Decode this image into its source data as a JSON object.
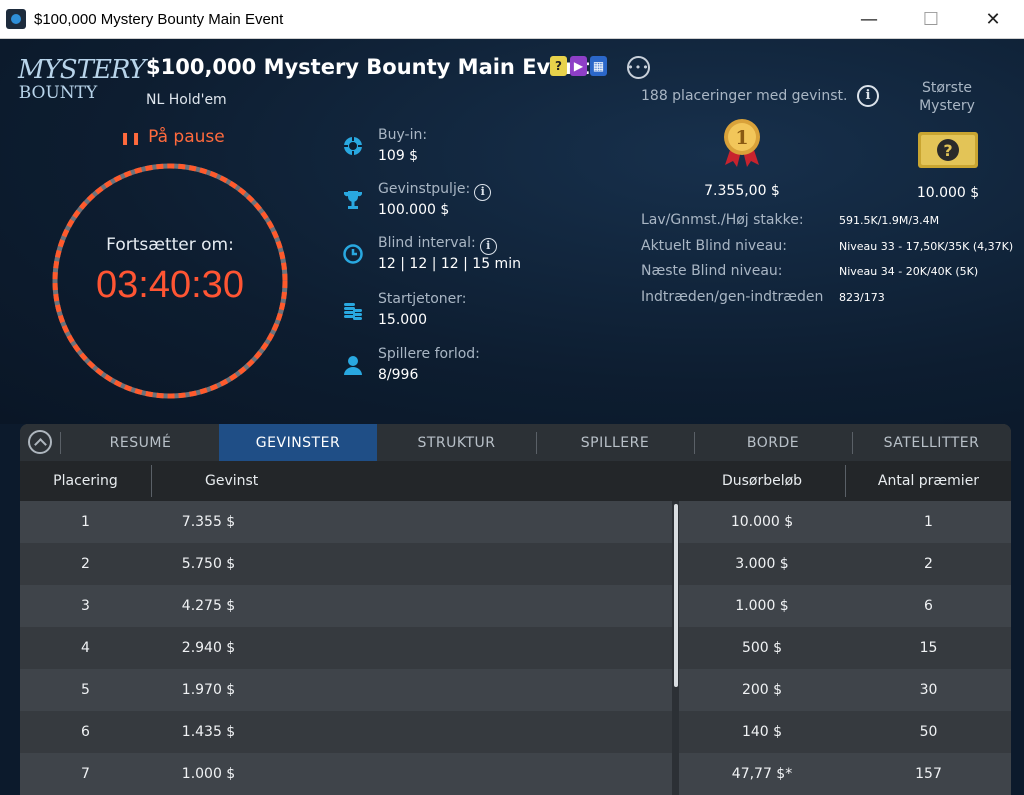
{
  "window": {
    "title": "$100,000 Mystery Bounty Main Event",
    "min": "—",
    "max": "☐",
    "close": "✕"
  },
  "logo": {
    "line1": "MYSTERY",
    "line2": "BOUNTY"
  },
  "event": {
    "title": "$100,000 Mystery Bounty Main Event",
    "game_type": "NL Hold'em",
    "more": "•••",
    "badges": [
      "?",
      "▶",
      "▦"
    ]
  },
  "status": {
    "paused": "På pause"
  },
  "clock": {
    "label": "Fortsætter om:",
    "time": "03:40:30"
  },
  "info": [
    {
      "label": "Buy-in:",
      "value": "109 $",
      "icon": "chip-icon",
      "info": false
    },
    {
      "label": "Gevinstpulje:",
      "value": "100.000 $",
      "icon": "trophy-icon",
      "info": true
    },
    {
      "label": "Blind interval:",
      "value": "12 | 12 | 12 | 15 min",
      "icon": "clock-icon",
      "info": true
    },
    {
      "label": "Startjetoner:",
      "value": "15.000",
      "icon": "chip-stack-icon",
      "info": false
    },
    {
      "label": "Spillere forlod:",
      "value": "8/996",
      "icon": "player-icon",
      "info": false
    }
  ],
  "prizes": {
    "paid_places": "188 placeringer med gevinst.",
    "first_prize": "7.355,00 $",
    "largest_label": "Største Mystery",
    "largest_amount": "10.000 $",
    "medal_number": "1"
  },
  "stats": [
    {
      "key": "Lav/Gnmst./Høj stakke:",
      "value": "591.5K/1.9M/3.4M"
    },
    {
      "key": "Aktuelt Blind niveau:",
      "value": "Niveau 33 - 17,50K/35K (4,37K)"
    },
    {
      "key": "Næste Blind niveau:",
      "value": "Niveau 34 - 20K/40K (5K)"
    },
    {
      "key": "Indtræden/gen-indtræden",
      "value": "823/173"
    }
  ],
  "tabs": [
    "RESUMÉ",
    "GEVINSTER",
    "STRUKTUR",
    "SPILLERE",
    "BORDE",
    "SATELLITTER"
  ],
  "active_tab": "GEVINSTER",
  "table": {
    "headers": {
      "place": "Placering",
      "prize": "Gevinst",
      "bounty": "Dusørbeløb",
      "count": "Antal præmier"
    },
    "left_rows": [
      {
        "place": "1",
        "prize": "7.355 $"
      },
      {
        "place": "2",
        "prize": "5.750 $"
      },
      {
        "place": "3",
        "prize": "4.275 $"
      },
      {
        "place": "4",
        "prize": "2.940 $"
      },
      {
        "place": "5",
        "prize": "1.970 $"
      },
      {
        "place": "6",
        "prize": "1.435 $"
      },
      {
        "place": "7",
        "prize": "1.000 $"
      }
    ],
    "right_rows": [
      {
        "bounty": "10.000 $",
        "count": "1"
      },
      {
        "bounty": "3.000 $",
        "count": "2"
      },
      {
        "bounty": "1.000 $",
        "count": "6"
      },
      {
        "bounty": "500 $",
        "count": "15"
      },
      {
        "bounty": "200 $",
        "count": "30"
      },
      {
        "bounty": "140 $",
        "count": "50"
      },
      {
        "bounty": "47,77 $*",
        "count": "157"
      }
    ]
  },
  "colors": {
    "accent": "#ff5533",
    "tab_active": "#1f4e86",
    "icon": "#29a8e0",
    "background": "#0c1a2c"
  }
}
